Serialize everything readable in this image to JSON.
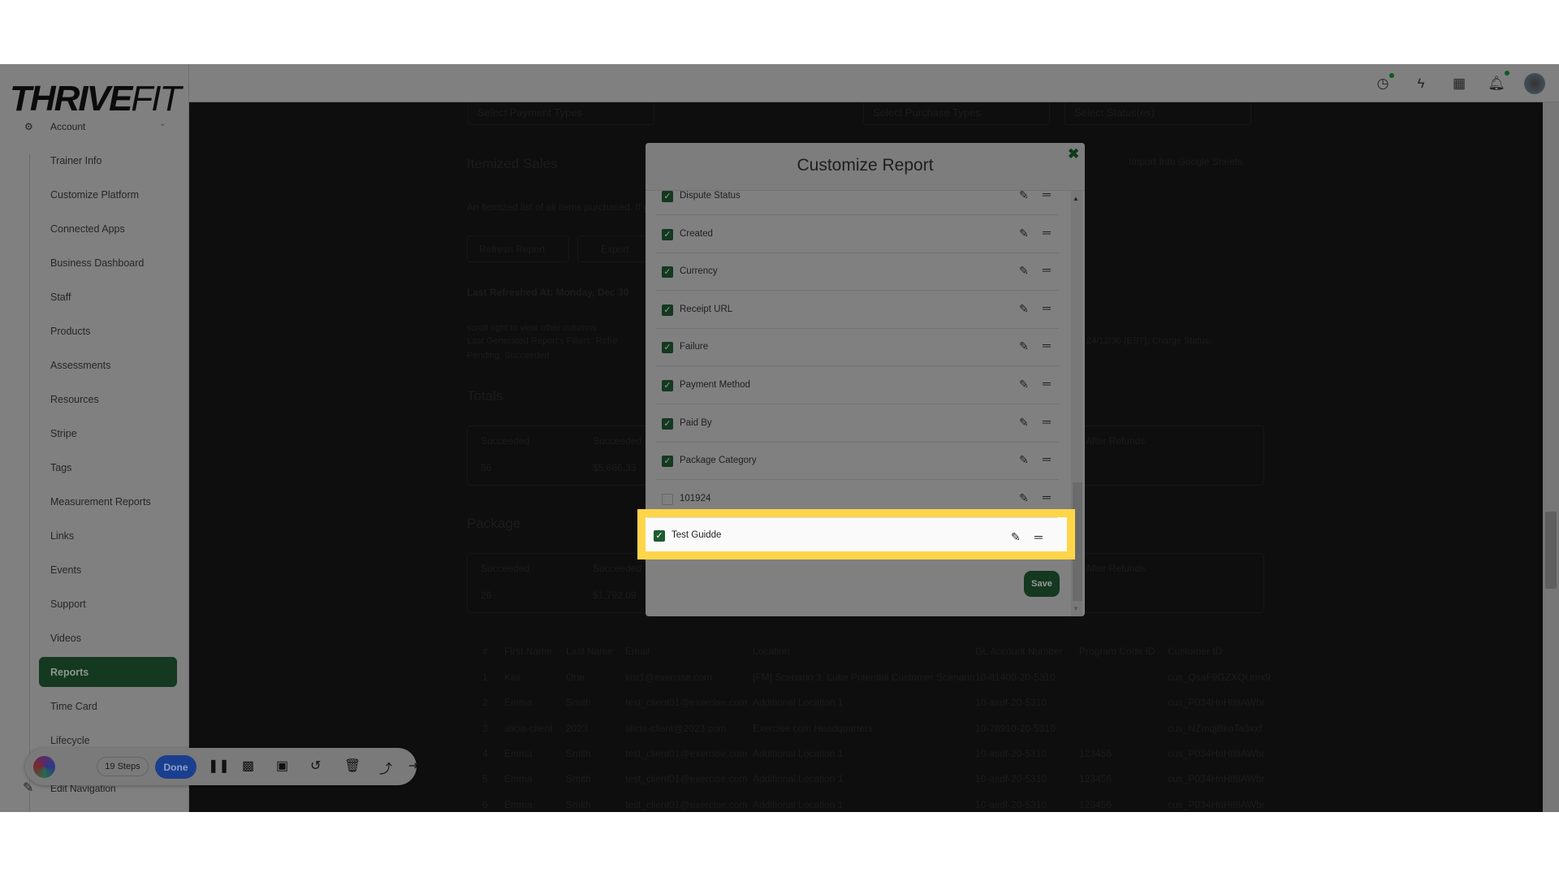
{
  "brand": {
    "logo_bold": "THRIVE",
    "logo_light": "FIT"
  },
  "sidebar": {
    "section": "Account",
    "items": [
      "Trainer Info",
      "Customize Platform",
      "Connected Apps",
      "Business Dashboard",
      "Staff",
      "Products",
      "Assessments",
      "Resources",
      "Stripe",
      "Tags",
      "Measurement Reports",
      "Links",
      "Events",
      "Support",
      "Videos",
      "Reports",
      "Time Card",
      "Lifecycle"
    ],
    "active": "Reports",
    "edit_navigation": "Edit Navigation"
  },
  "header": {
    "icons": [
      "clock-icon",
      "bolt-icon",
      "apps-grid-icon",
      "bell-icon",
      "avatar"
    ]
  },
  "background": {
    "filters": [
      "Select Payment Types",
      "Select Purchase Types",
      "Select Status(es)"
    ],
    "title": "Itemized Sales",
    "description": "An itemized list of all items purchased. If y",
    "import_sheets": "Import Into Google Sheets",
    "refresh": "Refresh Report",
    "export": "Export",
    "last_refreshed": "Last Refreshed At: Monday, Dec 30",
    "scroll_note": "scroll right to view other columns",
    "filters_note_a": "Last Generated Report's Filters: Refre",
    "filters_note_b": "24/12/30 (EST); Charge Status:",
    "filters_note_c": "Pending, Succeeded",
    "totals": {
      "title": "Totals",
      "col1": "Succeeded",
      "col2": "Succeeded",
      "col3": "After Refunds",
      "v1": "56",
      "v2": "$5,666.33"
    },
    "package": {
      "title": "Package",
      "col1": "Succeeded",
      "col2": "Succeeded",
      "col3": "After Refunds",
      "v1": "26",
      "v2": "$1,792.09"
    },
    "table": {
      "headers": [
        "#",
        "First Name",
        "Last Name",
        "Email",
        "Location",
        "GL Account Number",
        "Program Code ID",
        "Customer ID"
      ],
      "rows": [
        [
          "1",
          "Kisi",
          "One",
          "kisi1@exercise.com",
          "[FM] Scenario 3: Luke Potential Customer Scenario",
          "10-81400-20-5310",
          "",
          "cus_QsaF9GZXQUmx9"
        ],
        [
          "2",
          "Emma",
          "Smith",
          "test_client01@exercise.com",
          "Additional Location 1",
          "10-asdf-20-5310",
          "",
          "cus_P034HnHtl8AWbr"
        ],
        [
          "3",
          "alicia-client",
          "2023",
          "alicia-client@2023.com",
          "Exercise.com Headquarters",
          "10-78910-20-5310",
          "",
          "cus_NZmqjBkoTa3xxf"
        ],
        [
          "4",
          "Emma",
          "Smith",
          "test_client01@exercise.com",
          "Additional Location 1",
          "10-asdf-20-5310",
          "123456",
          "cus_P034HnHtl8AWbr"
        ],
        [
          "5",
          "Emma",
          "Smith",
          "test_client01@exercise.com",
          "Additional Location 1",
          "10-asdf-20-5310",
          "123456",
          "cus_P034HnHtl8AWbr"
        ],
        [
          "6",
          "Emma",
          "Smith",
          "test_client01@exercise.com",
          "Additional Location 1",
          "10-asdf-20-5310",
          "123456",
          "cus_P034HnHtl8AWbr"
        ]
      ]
    }
  },
  "modal": {
    "title": "Customize Report",
    "save": "Save",
    "columns": [
      {
        "label": "Dispute Status",
        "checked": true
      },
      {
        "label": "Created",
        "checked": true
      },
      {
        "label": "Currency",
        "checked": true
      },
      {
        "label": "Receipt URL",
        "checked": true
      },
      {
        "label": "Failure",
        "checked": true
      },
      {
        "label": "Payment Method",
        "checked": true
      },
      {
        "label": "Paid By",
        "checked": true
      },
      {
        "label": "Package Category",
        "checked": true
      },
      {
        "label": "101924",
        "checked": false
      }
    ],
    "highlighted": {
      "label": "Test Guidde",
      "checked": true
    }
  },
  "recorder": {
    "steps": "19 Steps",
    "done": "Done",
    "icons": [
      "pause-icon",
      "blur-icon",
      "image-icon",
      "undo-icon",
      "trash-icon",
      "upload-icon",
      "skip-icon"
    ]
  },
  "colors": {
    "accent": "#1f5c30",
    "highlight": "#ffd54a",
    "done": "#1b3f8f"
  }
}
